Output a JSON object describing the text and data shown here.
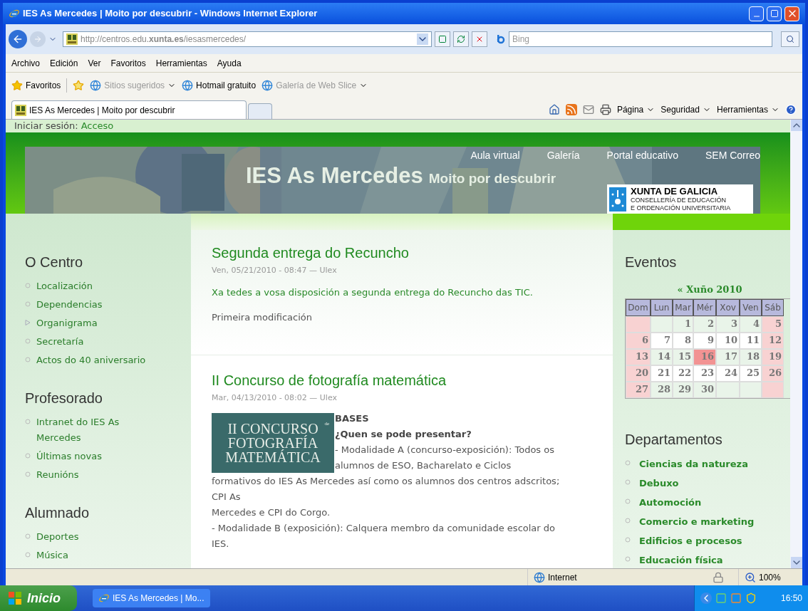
{
  "window": {
    "title": "IES As Mercedes | Moito por descubrir - Windows Internet Explorer"
  },
  "address_bar": {
    "url": "http://centros.edu.**xunta.es**/iesasmercedes/",
    "search_placeholder": "Bing"
  },
  "menu": [
    "Archivo",
    "Edición",
    "Ver",
    "Favoritos",
    "Herramientas",
    "Ayuda"
  ],
  "favorites_bar": {
    "label": "Favoritos",
    "items": [
      {
        "label": "Sitios sugeridos",
        "has_menu": true,
        "disabled": true
      },
      {
        "label": "Hotmail gratuito",
        "has_menu": false,
        "disabled": false
      },
      {
        "label": "Galería de Web Slice",
        "has_menu": true,
        "disabled": true
      }
    ]
  },
  "tabs": [
    {
      "label": "IES As Mercedes | Moito por descubrir",
      "selected": true
    }
  ],
  "command_bar": [
    "Página",
    "Seguridad",
    "Herramientas"
  ],
  "page": {
    "login": {
      "label": "Iniciar sesión:",
      "link": "Acceso"
    },
    "header": {
      "title": "IES As Mercedes",
      "slogan": "Moito por descubrir",
      "nav": [
        "Aula virtual",
        "Galería",
        "Portal educativo",
        "SEM Correo"
      ],
      "logo": {
        "title": "XUNTA DE GALICIA",
        "lines": [
          "CONSELLERÍA DE EDUCACIÓN",
          "E ORDENACIÓN UNIVERSITARIA"
        ]
      }
    },
    "left_blocks": [
      {
        "title": "O Centro",
        "items": [
          {
            "label": "Localización",
            "kind": "leaf"
          },
          {
            "label": "Dependencias",
            "kind": "leaf"
          },
          {
            "label": "Organigrama",
            "kind": "collapsed"
          },
          {
            "label": "Secretaría",
            "kind": "leaf"
          },
          {
            "label": "Actos do 40 aniversario",
            "kind": "leaf"
          }
        ]
      },
      {
        "title": "Profesorado",
        "items": [
          {
            "label": "Intranet do IES As Mercedes",
            "kind": "leaf"
          },
          {
            "label": "Últimas novas",
            "kind": "leaf"
          },
          {
            "label": "Reunións",
            "kind": "leaf"
          }
        ]
      },
      {
        "title": "Alumnado",
        "items": [
          {
            "label": "Deportes",
            "kind": "leaf"
          },
          {
            "label": "Música",
            "kind": "leaf"
          }
        ]
      }
    ],
    "articles": [
      {
        "title": "Segunda entrega do Recuncho",
        "meta": "Ven, 05/21/2010 - 08:47 — Ulex",
        "lead": "Xa tedes a vosa disposición a segunda entrega do Recuncho das TIC.",
        "paragraphs": [
          "Primeira modificación"
        ]
      },
      {
        "title": "II Concurso de fotografía matemática",
        "meta": "Mar, 04/13/2010 - 08:02 — Ulex",
        "image_lines": [
          "II CONCURSO",
          "FOTOGRAFÍA",
          "MATEMÁTICA"
        ],
        "image_mark": "de",
        "heading": "BASES",
        "subheading": "¿Quen se pode presentar?",
        "text_lines": [
          "- Modalidade A (concurso-exposición): Todos os",
          "alumnos de ESO, Bacharelato e Ciclos",
          "formativos do IES As Mercedes así como os alumnos dos centros adscritos;",
          "CPI As",
          "Mercedes e CPI do Corgo.",
          "- Modalidade B (exposición): Calquera membro da comunidade escolar do",
          "IES."
        ]
      }
    ],
    "calendar": {
      "title": "Eventos",
      "month": "« Xuño 2010",
      "weekdays": [
        "Dom",
        "Lun",
        "Mar",
        "Mér",
        "Xov",
        "Ven",
        "Sáb"
      ],
      "weeks": [
        [
          {
            "kind": "empty"
          },
          {
            "kind": "empty"
          },
          {
            "kind": "day",
            "day": "1",
            "today": false
          },
          {
            "kind": "day",
            "day": "2",
            "today": false
          },
          {
            "kind": "day",
            "day": "3",
            "today": false
          },
          {
            "kind": "day",
            "day": "4",
            "today": false
          },
          {
            "kind": "day",
            "day": "5",
            "today": false
          }
        ],
        [
          {
            "kind": "day",
            "day": "6",
            "today": false
          },
          {
            "kind": "day",
            "day": "7",
            "today": false
          },
          {
            "kind": "day",
            "day": "8",
            "today": false
          },
          {
            "kind": "day",
            "day": "9",
            "today": false
          },
          {
            "kind": "day",
            "day": "10",
            "today": false
          },
          {
            "kind": "day",
            "day": "11",
            "today": false
          },
          {
            "kind": "day",
            "day": "12",
            "today": false
          }
        ],
        [
          {
            "kind": "day",
            "day": "13",
            "today": false
          },
          {
            "kind": "day",
            "day": "14",
            "today": false
          },
          {
            "kind": "day",
            "day": "15",
            "today": false
          },
          {
            "kind": "day",
            "day": "16",
            "today": true
          },
          {
            "kind": "day",
            "day": "17",
            "today": false
          },
          {
            "kind": "day",
            "day": "18",
            "today": false
          },
          {
            "kind": "day",
            "day": "19",
            "today": false
          }
        ],
        [
          {
            "kind": "day",
            "day": "20",
            "today": false
          },
          {
            "kind": "day",
            "day": "21",
            "today": false
          },
          {
            "kind": "day",
            "day": "22",
            "today": false
          },
          {
            "kind": "day",
            "day": "23",
            "today": false
          },
          {
            "kind": "day",
            "day": "24",
            "today": false
          },
          {
            "kind": "day",
            "day": "25",
            "today": false
          },
          {
            "kind": "day",
            "day": "26",
            "today": false
          }
        ],
        [
          {
            "kind": "day",
            "day": "27",
            "today": false
          },
          {
            "kind": "day",
            "day": "28",
            "today": false
          },
          {
            "kind": "day",
            "day": "29",
            "today": false
          },
          {
            "kind": "day",
            "day": "30",
            "today": false
          },
          {
            "kind": "empty"
          },
          {
            "kind": "empty"
          },
          {
            "kind": "empty"
          }
        ]
      ]
    },
    "departments": {
      "title": "Departamentos",
      "items": [
        "Ciencias da natureza",
        "Debuxo",
        "Automoción",
        "Comercio e marketing",
        "Edificios e procesos",
        "Educación física"
      ]
    }
  },
  "status_bar": {
    "zone": "Internet",
    "zoom": "100%"
  },
  "taskbar": {
    "start": "Inicio",
    "tasks": [
      {
        "label": "IES As Mercedes | Mo...",
        "selected": false
      }
    ],
    "clock": "16:50"
  }
}
